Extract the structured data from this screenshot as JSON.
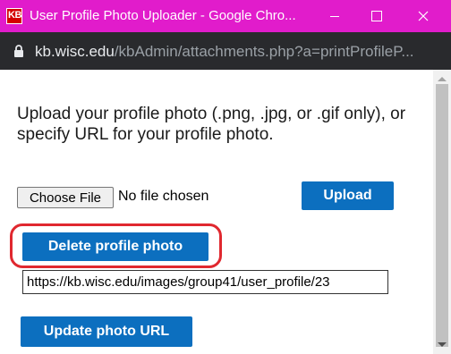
{
  "window": {
    "title": "User Profile Photo Uploader - Google Chro...",
    "app_icon_text": "KB",
    "icons": {
      "minimize": "minimize-icon",
      "maximize": "maximize-icon",
      "close": "close-icon"
    },
    "titlebar_color": "#e11ccb"
  },
  "address_bar": {
    "lock_icon": "lock-icon",
    "host": "kb.wisc.edu",
    "path": "/kbAdmin/attachments.php?a=printProfileP..."
  },
  "page": {
    "intro_text": "Upload your profile photo (.png, .jpg, or .gif only), or specify URL for your profile photo.",
    "choose_file_label": "Choose File",
    "no_file_text": "No file chosen",
    "upload_label": "Upload",
    "delete_label": "Delete profile photo",
    "photo_url_value": "https://kb.wisc.edu/images/group41/user_profile/23",
    "update_label": "Update photo URL",
    "accent_color": "#0c6fbf",
    "highlight_color": "#e0282f"
  }
}
